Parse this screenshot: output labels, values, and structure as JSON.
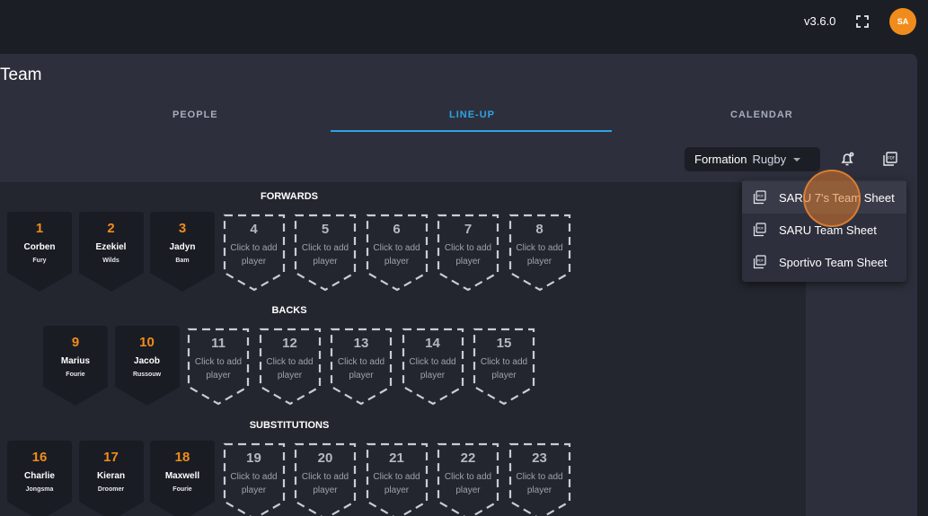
{
  "header": {
    "version": "v3.6.0",
    "avatar_initials": "SA",
    "fullscreen_icon": "fullscreen-icon"
  },
  "page": {
    "title": "Team"
  },
  "tabs": [
    {
      "label": "PEOPLE",
      "active": false
    },
    {
      "label": "LINE-UP",
      "active": true
    },
    {
      "label": "CALENDAR",
      "active": false
    }
  ],
  "toolbar": {
    "formation_label": "Formation",
    "formation_value": "Rugby",
    "notify_icon": "bell-settings-icon",
    "pdf_icon": "pdf-icon"
  },
  "sections": {
    "forwards": "FORWARDS",
    "backs": "BACKS",
    "substitutions": "SUBSTITUTIONS"
  },
  "empty_slot_hint": "Click to add player",
  "forwards": {
    "players": [
      {
        "number": "1",
        "first": "Corben",
        "last": "Fury"
      },
      {
        "number": "2",
        "first": "Ezekiel",
        "last": "Wilds"
      },
      {
        "number": "3",
        "first": "Jadyn",
        "last": "Bam"
      }
    ],
    "empty": [
      "4",
      "5",
      "6",
      "7",
      "8"
    ]
  },
  "backs": {
    "players": [
      {
        "number": "9",
        "first": "Marius",
        "last": "Fourie"
      },
      {
        "number": "10",
        "first": "Jacob",
        "last": "Russouw"
      }
    ],
    "empty": [
      "11",
      "12",
      "13",
      "14",
      "15"
    ]
  },
  "substitutions": {
    "players": [
      {
        "number": "16",
        "first": "Charlie",
        "last": "Jongsma"
      },
      {
        "number": "17",
        "first": "Kieran",
        "last": "Droomer"
      },
      {
        "number": "18",
        "first": "Maxwell",
        "last": "Fourie"
      }
    ],
    "empty": [
      "19",
      "20",
      "21",
      "22",
      "23"
    ]
  },
  "pdf_menu": {
    "items": [
      {
        "label": "SARU 7's Team Sheet"
      },
      {
        "label": "SARU Team Sheet"
      },
      {
        "label": "Sportivo Team Sheet"
      }
    ]
  },
  "colors": {
    "accent_orange": "#f08c1b",
    "active_tab_blue": "#2ea3e6",
    "card_bg": "#2d303c",
    "pitch_bg": "#23262f"
  }
}
